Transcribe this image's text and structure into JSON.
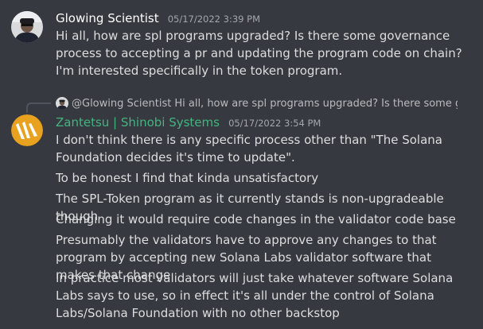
{
  "messages": [
    {
      "author": "Glowing Scientist",
      "author_color": "#ffffff",
      "timestamp": "05/17/2022 3:39 PM",
      "lines": [
        "Hi all, how are spl programs upgraded? Is there some governance process to accepting a pr and updating the program code on chain? I'm interested specifically in the token program."
      ]
    },
    {
      "reply": {
        "mention": "@Glowing Scientist",
        "text": "Hi all, how are spl programs upgraded? Is there some governa"
      },
      "author": "Zantetsu | Shinobi Systems",
      "author_color": "#43b581",
      "timestamp": "05/17/2022 3:54 PM",
      "lines": [
        "I don't think there is any specific process other than \"The Solana Foundation decides it's time to update\".",
        "To be honest I find that kinda unsatisfactory",
        "The SPL-Token program as it currently stands is non-upgradeable though",
        "Changing it would require code changes in the validator code base",
        "Presumably the validators have to approve any changes to that program by accepting new Solana Labs validator software that makes that change",
        "In practice most validators will just take whatever software Solana Labs says to use, so in effect it's all under the control of Solana Labs/Solana Foundation with no other backstop"
      ]
    }
  ]
}
